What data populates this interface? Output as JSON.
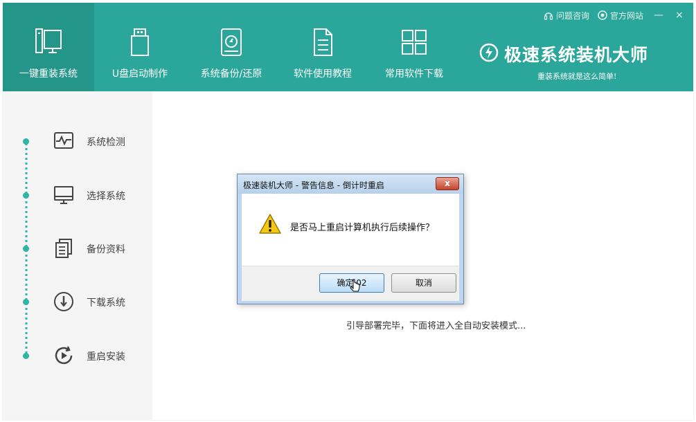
{
  "nav": {
    "items": [
      {
        "label": "一键重装系统",
        "icon": "monitor-tower-icon",
        "active": true
      },
      {
        "label": "U盘启动制作",
        "icon": "usb-drive-icon"
      },
      {
        "label": "系统备份/还原",
        "icon": "backup-disk-icon"
      },
      {
        "label": "软件使用教程",
        "icon": "document-icon"
      },
      {
        "label": "常用软件下载",
        "icon": "grid-apps-icon"
      }
    ]
  },
  "topbar": {
    "help": "问题咨询",
    "website": "官方网站",
    "minimize": "—",
    "close": "×"
  },
  "brand": {
    "title": "极速系统装机大师",
    "subtitle": "重装系统就是这么简单!"
  },
  "steps": [
    {
      "label": "系统检测",
      "icon": "pulse-monitor-icon"
    },
    {
      "label": "选择系统",
      "icon": "desktop-icon"
    },
    {
      "label": "备份资料",
      "icon": "copy-files-icon"
    },
    {
      "label": "下载系统",
      "icon": "download-circle-icon"
    },
    {
      "label": "重启安装",
      "icon": "restart-play-icon"
    }
  ],
  "status": {
    "text": "引导部署完毕，下面将进入全自动安装模式..."
  },
  "dialog": {
    "title": "极速装机大师 - 警告信息 - 倒计时重启",
    "close": "x",
    "message": "是否马上重启计算机执行后续操作？",
    "ok": "确定 02",
    "cancel": "取消"
  },
  "colors": {
    "header": "#2aa79a",
    "header_active": "#249689",
    "accent": "#2fb5a6"
  }
}
